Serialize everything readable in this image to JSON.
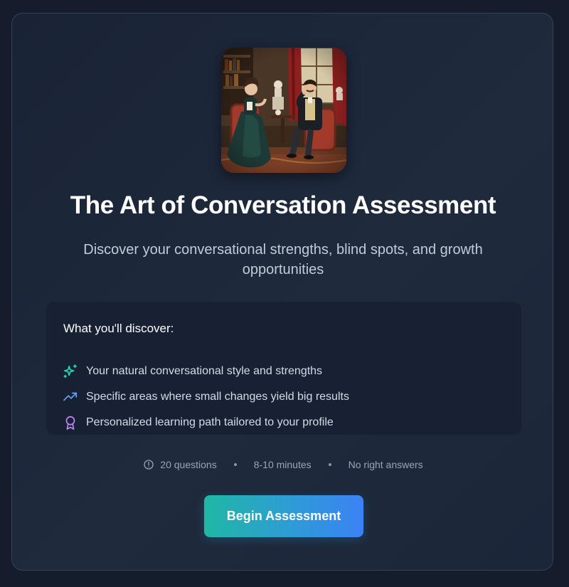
{
  "assessment": {
    "title": "The Art of Conversation Assessment",
    "subtitle": "Discover your conversational strengths, blind spots, and growth opportunities"
  },
  "discover": {
    "heading": "What you'll discover:",
    "items": [
      {
        "icon": "sparkles-icon",
        "color": "#2dd4bf",
        "label": "Your natural conversational style and strengths"
      },
      {
        "icon": "trending-up-icon",
        "color": "#60a5fa",
        "label": "Specific areas where small changes yield big results"
      },
      {
        "icon": "award-icon",
        "color": "#c084fc",
        "label": "Personalized learning path tailored to your profile"
      }
    ]
  },
  "meta": {
    "questions": "20 questions",
    "duration": "8-10 minutes",
    "note": "No right answers"
  },
  "cta": {
    "label": "Begin Assessment"
  },
  "colors": {
    "background": "#151c2c",
    "card": "#1c2537",
    "accent_start": "#1fb8a4",
    "accent_end": "#3b82f6"
  }
}
